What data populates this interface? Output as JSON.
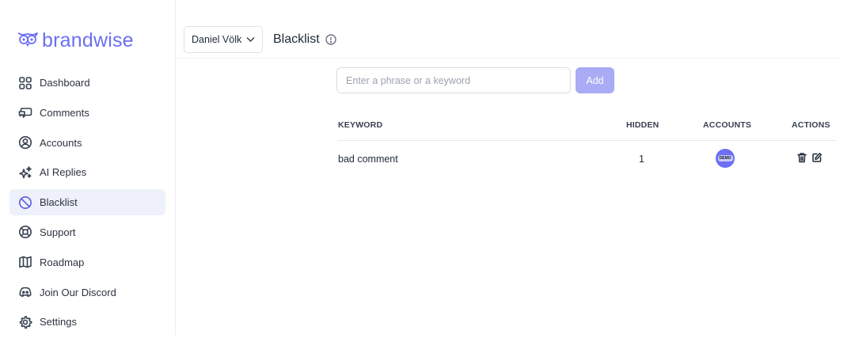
{
  "brand": {
    "name": "brandwise",
    "accent": "#6b6ff0",
    "icon": "owl-logo-icon"
  },
  "sidebar": {
    "items": [
      {
        "label": "Dashboard",
        "icon": "dashboard-icon",
        "active": false
      },
      {
        "label": "Comments",
        "icon": "comments-icon",
        "active": false
      },
      {
        "label": "Accounts",
        "icon": "user-circle-icon",
        "active": false
      },
      {
        "label": "AI Replies",
        "icon": "sparkles-icon",
        "active": false
      },
      {
        "label": "Blacklist",
        "icon": "ban-icon",
        "active": true
      },
      {
        "label": "Support",
        "icon": "lifebuoy-icon",
        "active": false
      },
      {
        "label": "Roadmap",
        "icon": "map-icon",
        "active": false
      },
      {
        "label": "Join Our Discord",
        "icon": "discord-icon",
        "active": false
      },
      {
        "label": "Settings",
        "icon": "gear-icon",
        "active": false
      }
    ]
  },
  "header": {
    "user_select": "Daniel Völk",
    "title": "Blacklist"
  },
  "form": {
    "placeholder": "Enter a phrase or a keyword",
    "value": "",
    "add_label": "Add"
  },
  "table": {
    "columns": [
      "KEYWORD",
      "HIDDEN",
      "ACCOUNTS",
      "ACTIONS"
    ],
    "rows": [
      {
        "keyword": "bad comment",
        "hidden": "1",
        "account_avatar": "DEMO"
      }
    ]
  },
  "colors": {
    "active_bg": "#eef0fb",
    "add_button": "#a9abf5",
    "avatar": "#6d70f2"
  }
}
